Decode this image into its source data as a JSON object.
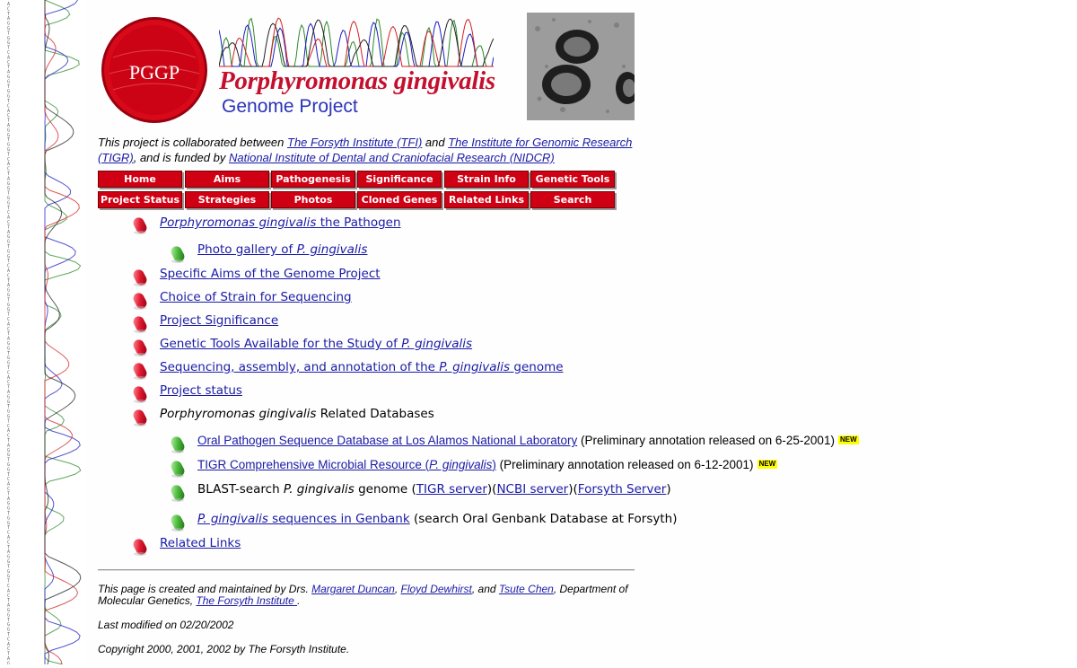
{
  "header": {
    "logo_text": "PGGP",
    "title": "Porphyromonas gingivalis",
    "subtitle": "Genome Project",
    "strip_letters": "ACTAGGTGGTCACTAGGTGGTCACTAGGTGGTCACTAGGTGGTCACTAGGTGGTCACTAGGTGGTCACTAGGTGGTCACTAGGTGGTCACTAGGTGGTCACTAGGTGGTCACTAGGTGGTCACTAGGTGGTCACTAGGTGGTC"
  },
  "collab": {
    "t1": "This project is collaborated between ",
    "forsyth": "The Forsyth Institute (TFI)",
    "t2": " and ",
    "tigr": "The Institute for Genomic Research (TIGR)",
    "t3": ", and is funded by ",
    "nidcr": "National Institute of Dental and Craniofacial Research (NIDCR)"
  },
  "nav": {
    "row1": [
      "Home",
      "Aims",
      "Pathogenesis",
      "Significance",
      "Strain Info",
      "Genetic Tools"
    ],
    "row2": [
      "Project Status",
      "Strategies",
      "Photos",
      "Cloned Genes",
      "Related Links",
      "Search"
    ]
  },
  "list": {
    "pathogen_genus": "Porphyromonas gingivalis",
    "pathogen_rest": " the Pathogen",
    "photo_a": "Photo gallery of ",
    "photo_b": "P. gingivalis",
    "aims": "Specific Aims of the Genome Project",
    "strain": "Choice of Strain for Sequencing",
    "significance": "Project Significance",
    "tools_a": "Genetic Tools Available for the Study of ",
    "tools_b": "P. gingivalis",
    "seq_a": "Sequencing, assembly, and annotation of the ",
    "seq_b": "P. gingivalis",
    "seq_c": " genome",
    "status": "Project status",
    "db_genus": "Porphyromonas gingivalis",
    "db_rest": " Related Databases",
    "oral": "Oral Pathogen Sequence Database at Los Alamos National Laboratory",
    "oral_note": " (Preliminary annotation released on 6-25-2001)",
    "tigr_a": "TIGR Comprehensive Microbial Resource (",
    "tigr_b": "P. gingivalis",
    "tigr_c": ")",
    "tigr_note": " (Preliminary annotation released on 6-12-2001)",
    "new_badge": "NEW",
    "blast_a": "BLAST-search ",
    "blast_b": "P. gingivalis",
    "blast_c": " genome (",
    "blast_tigr": "TIGR server",
    "blast_d": ")(",
    "blast_ncbi": "NCBI server",
    "blast_e": ")(",
    "blast_forsyth": "Forsyth Server",
    "blast_f": ")",
    "genbank_a": "P. gingivalis",
    "genbank_b": " sequences in Genbank",
    "genbank_note": " (search Oral Genbank Database at Forsyth)",
    "related": "Related Links"
  },
  "footer": {
    "f1": "This page is created and maintained by Drs. ",
    "duncan": "Margaret Duncan",
    "sep1": ", ",
    "dewhirst": "Floyd Dewhirst",
    "sep2": ", and ",
    "chen": "Tsute Chen",
    "f2": ", Department of Molecular Genetics, ",
    "forsyth": "The Forsyth Institute ",
    "f3": ".",
    "modified": "Last modified on 02/20/2002",
    "copyright": "Copyright 2000, 2001, 2002 by The Forsyth Institute."
  },
  "colors": {
    "brand_red": "#d00014",
    "title_red": "#c4102e",
    "subtitle_blue": "#2a33b8",
    "link_blue": "#1a1aa6"
  }
}
